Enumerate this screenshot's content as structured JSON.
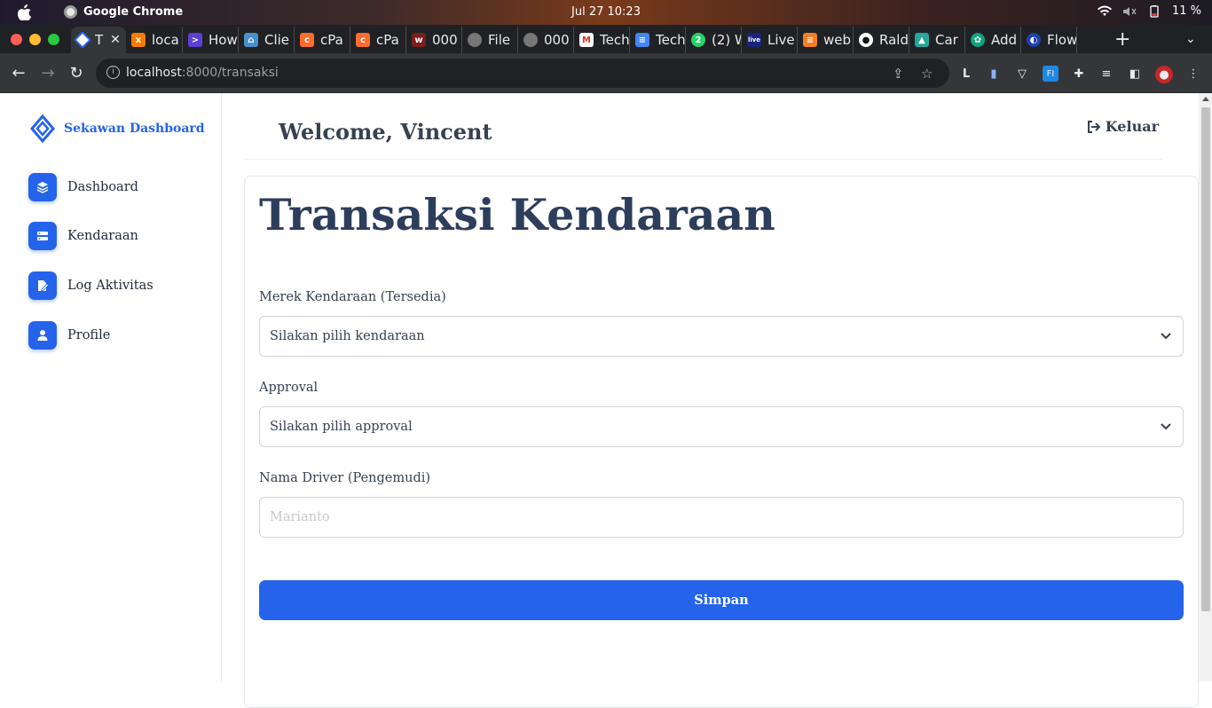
{
  "os": {
    "app_name": "Google Chrome",
    "clock": "Jul 27  10:23",
    "battery": "11 %"
  },
  "tabs": [
    {
      "label": "T",
      "favicon": "sekawan-icon",
      "active": true
    },
    {
      "label": "loca",
      "favicon": "xampp-icon"
    },
    {
      "label": "How",
      "favicon": "terminal-icon"
    },
    {
      "label": "Clie",
      "favicon": "house-icon"
    },
    {
      "label": "cPa",
      "favicon": "cpanel-icon"
    },
    {
      "label": "cPa",
      "favicon": "cpanel-icon"
    },
    {
      "label": "000",
      "favicon": "000webhost-icon"
    },
    {
      "label": "File",
      "favicon": "globe-icon"
    },
    {
      "label": "000",
      "favicon": "globe-icon"
    },
    {
      "label": "Tech",
      "favicon": "gmail-icon"
    },
    {
      "label": "Tech",
      "favicon": "docs-icon"
    },
    {
      "label": "(2) W",
      "favicon": "whatsapp-icon"
    },
    {
      "label": "Live",
      "favicon": "live-icon"
    },
    {
      "label": "web",
      "favicon": "stackoverflow-icon"
    },
    {
      "label": "Rald",
      "favicon": "github-icon"
    },
    {
      "label": "Car",
      "favicon": "car-icon"
    },
    {
      "label": "Add",
      "favicon": "chatgpt-icon"
    },
    {
      "label": "Flow",
      "favicon": "flow-icon"
    }
  ],
  "address_bar": {
    "host": "localhost",
    "rest": ":8000/transaksi"
  },
  "sidebar": {
    "brand": "Sekawan Dashboard",
    "items": [
      {
        "label": "Dashboard",
        "icon": "layers-icon"
      },
      {
        "label": "Kendaraan",
        "icon": "server-icon"
      },
      {
        "label": "Log Aktivitas",
        "icon": "file-edit-icon"
      },
      {
        "label": "Profile",
        "icon": "user-icon"
      }
    ]
  },
  "header": {
    "welcome": "Welcome, Vincent",
    "logout": "Keluar"
  },
  "form": {
    "title": "Transaksi Kendaraan",
    "vehicle_label": "Merek Kendaraan (Tersedia)",
    "vehicle_value": "Silakan pilih kendaraan",
    "approval_label": "Approval",
    "approval_value": "Silakan pilih approval",
    "driver_label": "Nama Driver (Pengemudi)",
    "driver_placeholder": "Marianto",
    "submit": "Simpan"
  },
  "colors": {
    "accent": "#2563eb",
    "title": "#2d3e5c"
  }
}
